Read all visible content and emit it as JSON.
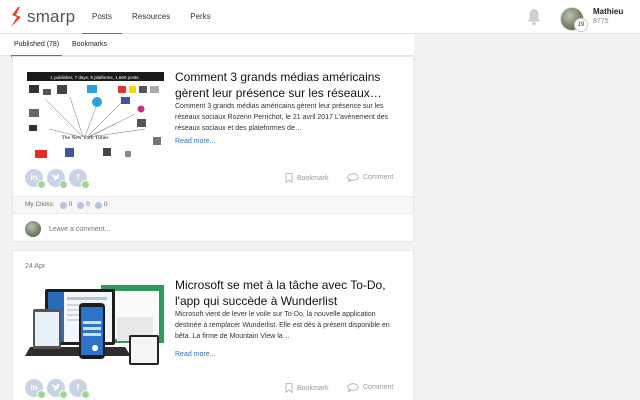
{
  "brand": {
    "name": "smarp",
    "accent": "#e8412e"
  },
  "nav": {
    "items": [
      {
        "label": "Posts"
      },
      {
        "label": "Resources"
      },
      {
        "label": "Perks"
      }
    ]
  },
  "user": {
    "name": "Mathieu",
    "points": "8775",
    "level": "19"
  },
  "subtabs": {
    "published": "Published (78)",
    "bookmarks": "Bookmarks"
  },
  "posts": [
    {
      "date": "",
      "thumb_caption": "1 publisher, 7 days, 9 platforms, 1,660 posts.",
      "thumb_logo": "The New York Times",
      "title": "Comment 3 grands médias américains gèrent leur présence sur les réseaux…",
      "excerpt": "Comment 3 grands médias américains gèrent leur présence sur les réseaux sociaux Rozenn Perrichot, le 21 avril 2017 L'avènement des réseaux sociaux et des plateformes de…",
      "read_more": "Read more...",
      "bookmark": "Bookmark",
      "comment": "Comment",
      "clicks_label": "My Clicks:",
      "clicks": {
        "linkedin": "0",
        "twitter": "0",
        "facebook": "0"
      },
      "comment_placeholder": "Leave a comment..."
    },
    {
      "date": "24 Apr",
      "title": "Microsoft se met à la tâche avec To-Do, l'app qui succède à Wunderlist",
      "excerpt": "Microsoft vient de lever le voile sur To-Do, la nouvelle application destinée à remplacer Wunderlist. Elle est dès à présent disponible en bêta. La firme de Mountain View la…",
      "read_more": "Read more...",
      "bookmark": "Bookmark",
      "comment": "Comment"
    }
  ],
  "icons": [
    "logo-icon",
    "bell-icon",
    "linkedin-icon",
    "twitter-icon",
    "facebook-icon",
    "bookmark-icon",
    "comment-icon"
  ]
}
